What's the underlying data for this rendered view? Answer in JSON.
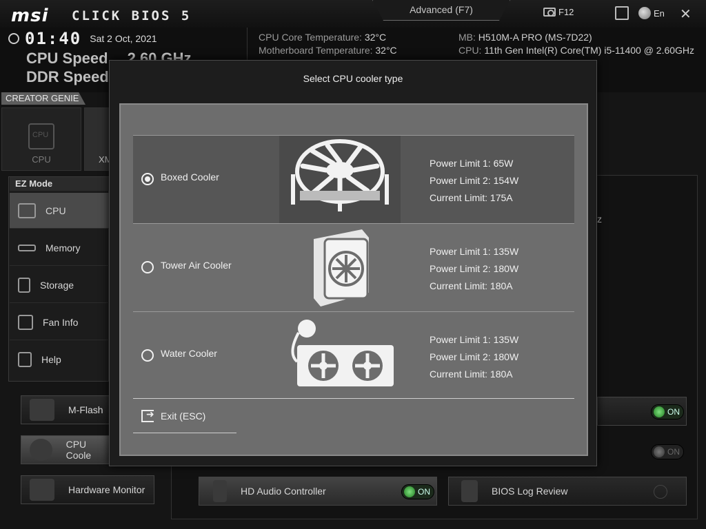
{
  "topbar": {
    "brand": "msi",
    "product": "CLICK BIOS 5",
    "mode_tab": "Advanced (F7)",
    "screenshot_key": "F12",
    "language": "En"
  },
  "header": {
    "time": "01:40",
    "date": "Sat  2 Oct, 2021",
    "cpu_speed_label": "CPU Speed",
    "cpu_speed_value": "2.60 GHz",
    "ddr_speed_label": "DDR Speed",
    "cpu_temp_label": "CPU Core Temperature:",
    "cpu_temp_value": "32°C",
    "mb_temp_label": "Motherboard Temperature:",
    "mb_temp_value": "32°C",
    "mb_label": "MB:",
    "mb_value": "H510M-A PRO (MS-7D22)",
    "cpu_label": "CPU:",
    "cpu_value": "11th Gen Intel(R) Core(TM) i5-11400 @ 2.60GHz"
  },
  "creator_genie": {
    "title": "CREATOR GENIE",
    "cards": [
      "CPU",
      "XM"
    ]
  },
  "ez_mode": {
    "title": "EZ Mode",
    "items": [
      "CPU",
      "Memory",
      "Storage",
      "Fan Info",
      "Help"
    ]
  },
  "bottom_buttons": {
    "mflash": "M-Flash",
    "cpu_cooler": "CPU Coole",
    "hardware_monitor": "Hardware Monitor",
    "hd_audio": "HD Audio Controller",
    "bios_log": "BIOS Log Review",
    "on": "ON"
  },
  "main": {
    "partial_text": "z"
  },
  "modal": {
    "title": "Select CPU cooler type",
    "options": [
      {
        "label": "Boxed Cooler",
        "specs": [
          "Power Limit 1: 65W",
          "Power Limit 2: 154W",
          "Current Limit: 175A"
        ],
        "selected": true
      },
      {
        "label": "Tower Air Cooler",
        "specs": [
          "Power Limit 1: 135W",
          "Power Limit 2: 180W",
          "Current Limit: 180A"
        ],
        "selected": false
      },
      {
        "label": "Water Cooler",
        "specs": [
          "Power Limit 1: 135W",
          "Power Limit 2: 180W",
          "Current Limit: 180A"
        ],
        "selected": false
      }
    ],
    "exit": "Exit (ESC)"
  },
  "icons": {
    "clock": "clock-icon",
    "camera": "camera-icon",
    "search": "search-icon",
    "globe": "globe-icon",
    "close": "close-icon",
    "exit": "exit-icon"
  }
}
